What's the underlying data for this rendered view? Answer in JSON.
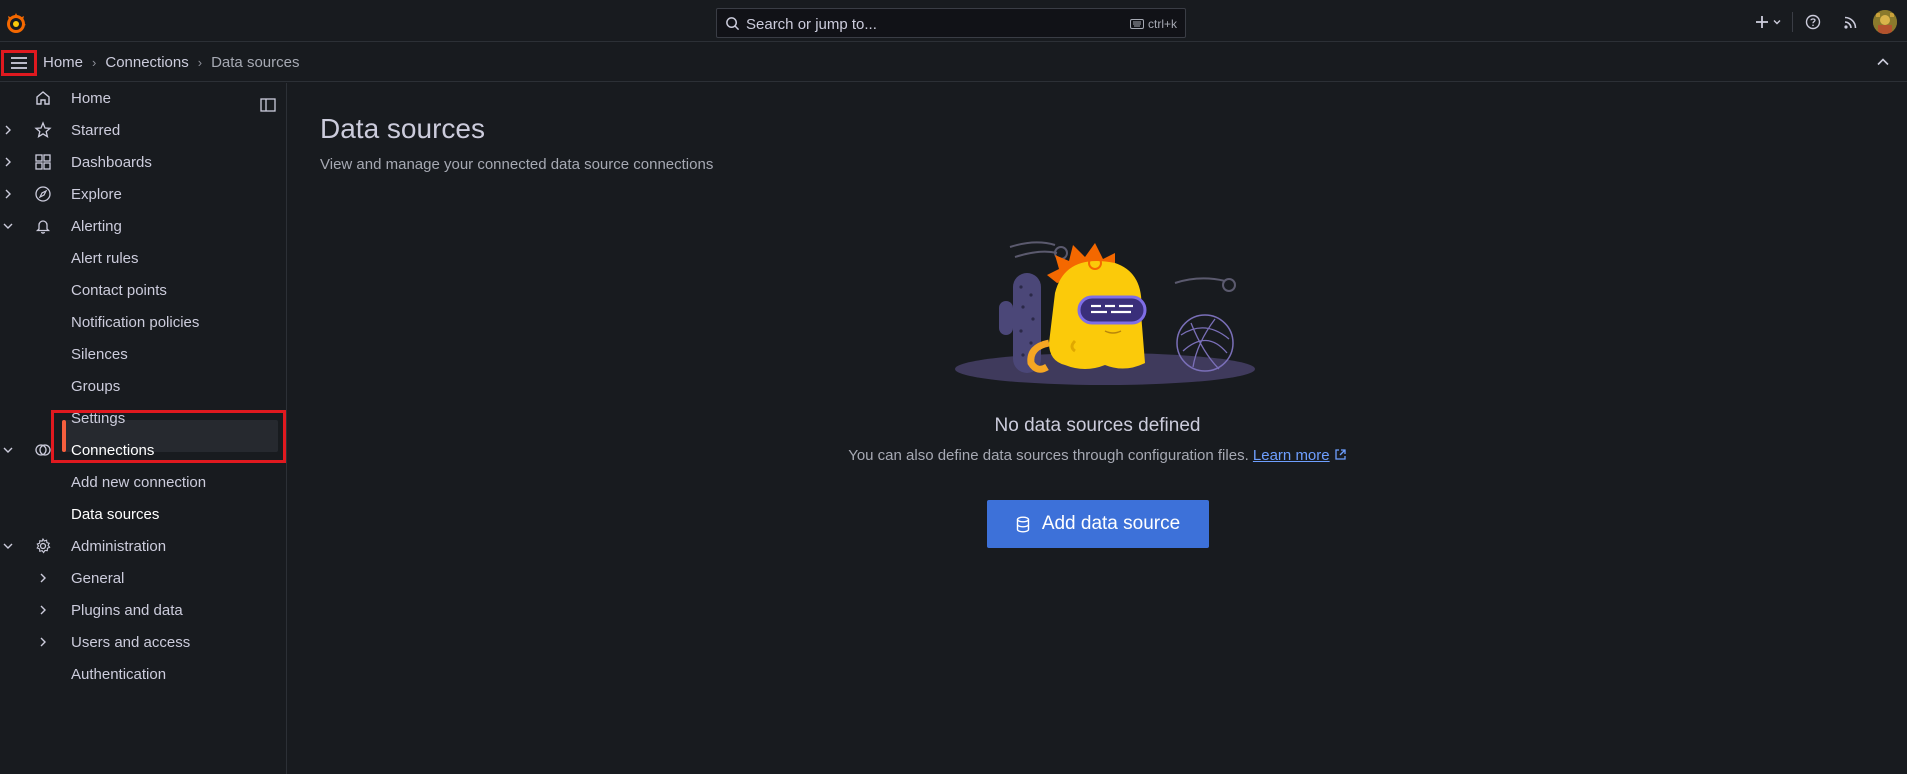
{
  "search": {
    "placeholder": "Search or jump to...",
    "shortcut": "ctrl+k"
  },
  "breadcrumb": [
    "Home",
    "Connections",
    "Data sources"
  ],
  "sidebar": {
    "items": [
      {
        "label": "Home"
      },
      {
        "label": "Starred"
      },
      {
        "label": "Dashboards"
      },
      {
        "label": "Explore"
      },
      {
        "label": "Alerting"
      },
      {
        "label": "Alert rules"
      },
      {
        "label": "Contact points"
      },
      {
        "label": "Notification policies"
      },
      {
        "label": "Silences"
      },
      {
        "label": "Groups"
      },
      {
        "label": "Settings"
      },
      {
        "label": "Connections"
      },
      {
        "label": "Add new connection"
      },
      {
        "label": "Data sources"
      },
      {
        "label": "Administration"
      },
      {
        "label": "General"
      },
      {
        "label": "Plugins and data"
      },
      {
        "label": "Users and access"
      },
      {
        "label": "Authentication"
      }
    ]
  },
  "main": {
    "title": "Data sources",
    "subtitle": "View and manage your connected data source connections",
    "empty_title": "No data sources defined",
    "empty_text": "You can also define data sources through configuration files.",
    "learn_more": "Learn more",
    "add_button": "Add data source"
  },
  "colors": {
    "accent": "#f55f3e",
    "primary": "#3d71d9",
    "highlight": "#e0191f",
    "link": "#6e9fff"
  },
  "icons": [
    "grafana-logo",
    "search-icon",
    "keyboard-icon",
    "plus-icon",
    "chevron-down-icon",
    "help-icon",
    "rss-icon",
    "menu-icon",
    "chevron-up-icon",
    "home-icon",
    "star-icon",
    "dashboards-icon",
    "compass-icon",
    "bell-icon",
    "connections-icon",
    "gear-icon",
    "dock-icon",
    "database-icon",
    "external-link-icon"
  ]
}
